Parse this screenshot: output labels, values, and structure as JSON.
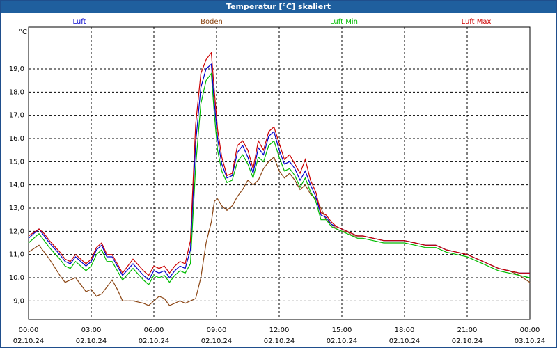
{
  "window": {
    "title": "Temperatur [°C] skaliert"
  },
  "colors": {
    "luft": "#0000cc",
    "boden": "#8b4513",
    "luft_min": "#00bb00",
    "luft_max": "#cc0000",
    "grid": "#000000",
    "titlebar": "#1f5f9e"
  },
  "chart_data": {
    "type": "line",
    "title": "Temperatur [°C] skaliert",
    "ylabel": "°C",
    "xlabel": "",
    "ylim": [
      8.2,
      20.8
    ],
    "xlim": [
      0,
      24
    ],
    "grid": true,
    "legend_position": "top",
    "y_ticks": [
      "9,0",
      "10,0",
      "11,0",
      "12,0",
      "13,0",
      "14,0",
      "15,0",
      "16,0",
      "17,0",
      "18,0",
      "19,0"
    ],
    "x_ticks": [
      {
        "time": "00:00",
        "date": "02.10.24"
      },
      {
        "time": "03:00",
        "date": "02.10.24"
      },
      {
        "time": "06:00",
        "date": "02.10.24"
      },
      {
        "time": "09:00",
        "date": "02.10.24"
      },
      {
        "time": "12:00",
        "date": "02.10.24"
      },
      {
        "time": "15:00",
        "date": "02.10.24"
      },
      {
        "time": "18:00",
        "date": "02.10.24"
      },
      {
        "time": "21:00",
        "date": "02.10.24"
      },
      {
        "time": "00:00",
        "date": "03.10.24"
      }
    ],
    "x": [
      0,
      0.5,
      0.75,
      1,
      1.5,
      1.75,
      2,
      2.25,
      2.5,
      2.75,
      3,
      3.25,
      3.5,
      3.75,
      4,
      4.25,
      4.5,
      5,
      5.5,
      5.75,
      6,
      6.25,
      6.5,
      6.75,
      7,
      7.25,
      7.5,
      7.75,
      8,
      8.25,
      8.5,
      8.75,
      8.9,
      9.05,
      9.25,
      9.5,
      9.75,
      10,
      10.25,
      10.5,
      10.75,
      11,
      11.25,
      11.5,
      11.75,
      12,
      12.25,
      12.5,
      12.75,
      13,
      13.25,
      13.5,
      13.75,
      14,
      14.25,
      14.5,
      14.75,
      15,
      15.25,
      15.5,
      15.75,
      16,
      16.5,
      17,
      17.5,
      18,
      18.5,
      19,
      19.5,
      20,
      20.5,
      21,
      21.5,
      22,
      22.5,
      23,
      23.5,
      24
    ],
    "series": [
      {
        "name": "Luft",
        "color": "#0000cc",
        "values": [
          11.7,
          12.1,
          11.8,
          11.5,
          11.0,
          10.7,
          10.6,
          10.9,
          10.7,
          10.5,
          10.7,
          11.2,
          11.4,
          10.9,
          10.9,
          10.5,
          10.1,
          10.6,
          10.1,
          9.9,
          10.3,
          10.2,
          10.3,
          10.0,
          10.3,
          10.5,
          10.4,
          11.2,
          15.8,
          18.2,
          19.0,
          19.2,
          17.5,
          16.0,
          14.9,
          14.3,
          14.4,
          15.4,
          15.7,
          15.2,
          14.5,
          15.6,
          15.3,
          16.1,
          16.3,
          15.5,
          14.9,
          15.0,
          14.7,
          14.2,
          14.6,
          14.0,
          13.5,
          12.7,
          12.6,
          12.3,
          12.2,
          12.1,
          12.0,
          11.9,
          11.8,
          11.8,
          11.7,
          11.6,
          11.6,
          11.6,
          11.5,
          11.4,
          11.4,
          11.2,
          11.1,
          11.0,
          10.8,
          10.6,
          10.4,
          10.3,
          10.2,
          10.2
        ]
      },
      {
        "name": "Boden",
        "color": "#8b4513",
        "values": [
          11.1,
          11.4,
          11.1,
          10.8,
          10.1,
          9.8,
          9.9,
          10.0,
          9.7,
          9.4,
          9.5,
          9.2,
          9.3,
          9.6,
          9.9,
          9.5,
          9.0,
          9.0,
          8.9,
          8.8,
          9.0,
          9.2,
          9.1,
          8.8,
          8.9,
          9.0,
          8.9,
          9.0,
          9.1,
          10.0,
          11.5,
          12.4,
          13.3,
          13.4,
          13.1,
          12.9,
          13.1,
          13.5,
          13.8,
          14.2,
          14.0,
          14.2,
          14.7,
          15.0,
          15.2,
          14.6,
          14.3,
          14.5,
          14.2,
          13.8,
          14.0,
          13.6,
          13.4,
          13.0,
          12.5,
          12.3,
          12.1,
          12.0,
          12.0,
          11.8,
          11.8,
          11.8,
          11.7,
          11.6,
          11.6,
          11.6,
          11.5,
          11.4,
          11.4,
          11.2,
          11.1,
          11.0,
          10.8,
          10.6,
          10.4,
          10.3,
          10.1,
          9.8
        ]
      },
      {
        "name": "Luft Min",
        "color": "#00bb00",
        "values": [
          11.5,
          11.9,
          11.6,
          11.3,
          10.8,
          10.5,
          10.4,
          10.7,
          10.5,
          10.3,
          10.5,
          11.0,
          11.2,
          10.7,
          10.7,
          10.3,
          9.9,
          10.4,
          9.9,
          9.7,
          10.1,
          10.0,
          10.1,
          9.8,
          10.1,
          10.3,
          10.2,
          10.6,
          14.8,
          17.5,
          18.5,
          18.8,
          17.0,
          15.5,
          14.6,
          14.1,
          14.2,
          15.0,
          15.3,
          14.9,
          14.3,
          15.2,
          15.0,
          15.7,
          15.9,
          15.2,
          14.6,
          14.7,
          14.4,
          13.9,
          14.3,
          13.7,
          13.3,
          12.5,
          12.5,
          12.2,
          12.1,
          12.0,
          11.9,
          11.8,
          11.7,
          11.7,
          11.6,
          11.5,
          11.5,
          11.5,
          11.4,
          11.3,
          11.3,
          11.1,
          11.0,
          10.9,
          10.7,
          10.5,
          10.3,
          10.2,
          10.1,
          10.0
        ]
      },
      {
        "name": "Luft Max",
        "color": "#cc0000",
        "values": [
          11.8,
          12.1,
          11.9,
          11.6,
          11.1,
          10.8,
          10.7,
          11.0,
          10.8,
          10.6,
          10.8,
          11.3,
          11.5,
          11.0,
          11.0,
          10.6,
          10.2,
          10.8,
          10.3,
          10.1,
          10.5,
          10.4,
          10.5,
          10.2,
          10.5,
          10.7,
          10.6,
          11.6,
          16.6,
          18.8,
          19.4,
          19.7,
          18.0,
          16.4,
          15.2,
          14.4,
          14.5,
          15.7,
          15.9,
          15.5,
          14.7,
          15.9,
          15.5,
          16.3,
          16.5,
          15.8,
          15.1,
          15.3,
          14.9,
          14.5,
          15.1,
          14.2,
          13.7,
          12.8,
          12.7,
          12.4,
          12.2,
          12.1,
          12.0,
          11.9,
          11.8,
          11.8,
          11.7,
          11.6,
          11.6,
          11.6,
          11.5,
          11.4,
          11.4,
          11.2,
          11.1,
          11.0,
          10.8,
          10.6,
          10.4,
          10.3,
          10.2,
          10.2
        ]
      }
    ]
  }
}
